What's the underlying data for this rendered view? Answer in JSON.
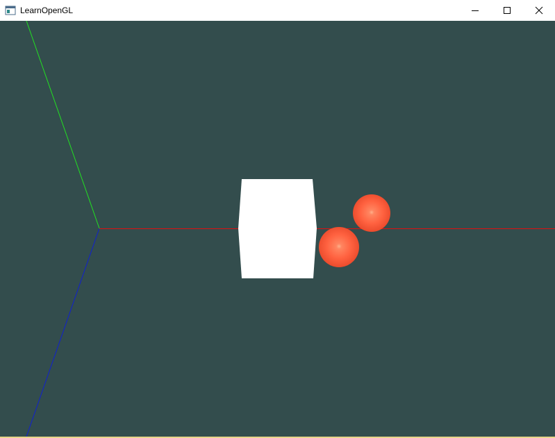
{
  "window": {
    "title": "LearnOpenGL",
    "icon": "app-window-icon",
    "controls": {
      "minimize_icon": "minimize-icon",
      "maximize_icon": "maximize-icon",
      "close_icon": "close-icon"
    }
  },
  "scene": {
    "background_color": "#334d4d",
    "axes": {
      "x_color": "#e01010",
      "y_color": "#22e022",
      "z_color": "#1020d0"
    },
    "cube_color": "#ffffff",
    "sphere_color": "#ff5f3d",
    "sphere_count": 2
  }
}
